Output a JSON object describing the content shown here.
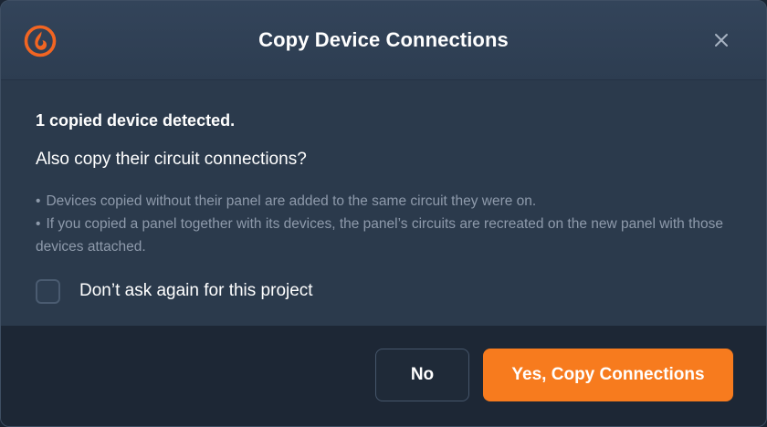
{
  "dialog": {
    "title": "Copy Device Connections",
    "logo_icon": "flame-logo-icon",
    "close_icon": "close-icon"
  },
  "body": {
    "detected_text": "1 copied device detected.",
    "question_text": "Also copy their circuit connections?",
    "notes": [
      "Devices copied without their panel are added to the same circuit they were on.",
      "If you copied a panel together with its devices, the panel’s circuits are recreated on the new panel with those devices attached."
    ],
    "bullet": "•",
    "dont_ask_label": "Don’t ask again for this project",
    "dont_ask_checked": false
  },
  "footer": {
    "no_label": "No",
    "yes_label": "Yes, Copy Connections"
  },
  "colors": {
    "accent": "#f77b1e",
    "logo": "#f26522",
    "background": "#2b3a4c",
    "footer_background": "#1d2735"
  }
}
